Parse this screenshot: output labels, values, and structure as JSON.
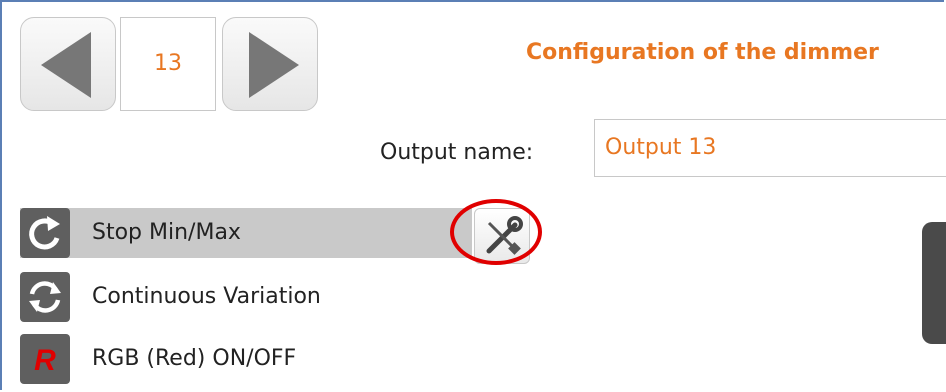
{
  "navigator": {
    "current_number": "13",
    "prev_icon": "left-triangle-icon",
    "next_icon": "right-triangle-icon"
  },
  "title": "Configuration of the dimmer",
  "output": {
    "label": "Output name:",
    "value": "Output 13"
  },
  "modes": [
    {
      "label": "Stop Min/Max",
      "icon": "rotate-arrow-icon",
      "selected": true
    },
    {
      "label": "Continuous Variation",
      "icon": "refresh-cycle-icon",
      "selected": false
    },
    {
      "label": "RGB (Red) ON/OFF",
      "icon": "red-r-icon",
      "selected": false
    }
  ],
  "settings_icon": "wrench-screwdriver-icon",
  "colors": {
    "accent": "#e87722",
    "icon_bg": "#5f5f5f",
    "selected_row": "#c9c9c9",
    "highlight": "#e00000"
  }
}
